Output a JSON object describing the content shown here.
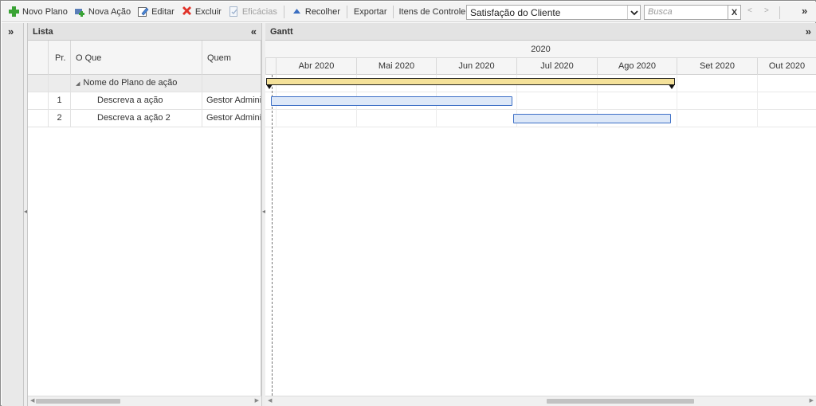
{
  "toolbar": {
    "new_plan": "Novo Plano",
    "new_action": "Nova Ação",
    "edit": "Editar",
    "delete": "Excluir",
    "efficacies": "Eficácias",
    "collapse": "Recolher",
    "export": "Exportar",
    "control_items_label": "Itens de Controle:",
    "control_items_value": "Satisfação do Cliente",
    "search_placeholder": "Busca",
    "clear_label": "X",
    "prev_label": "<",
    "next_label": ">",
    "more_label": "»"
  },
  "left_strip": {
    "expand_label": "»"
  },
  "list_panel": {
    "title": "Lista",
    "collapse_label": "«",
    "columns": {
      "priority": "Pr.",
      "what": "O Que",
      "who": "Quem"
    },
    "group_row": {
      "label": "Nome do Plano de ação"
    },
    "rows": [
      {
        "priority": "1",
        "what": "Descreva a ação",
        "who": "Gestor Administrador"
      },
      {
        "priority": "2",
        "what": "Descreva a ação 2",
        "who": "Gestor Administrador"
      }
    ]
  },
  "gantt_panel": {
    "title": "Gantt",
    "expand_label": "»",
    "year": "2020",
    "months": [
      "Abr 2020",
      "Mai 2020",
      "Jun 2020",
      "Jul 2020",
      "Ago 2020",
      "Set 2020",
      "Out 2020"
    ]
  },
  "colors": {
    "summary_fill": "#f4e199",
    "task_fill": "#dde8f8",
    "task_border": "#3d6fc6",
    "add_icon": "#3aa335",
    "delete_icon": "#e0332a",
    "collapse_icon": "#3b6fc1"
  },
  "icons": {
    "new_plan": "plus-icon",
    "new_action": "add-action-icon",
    "edit": "edit-icon",
    "delete": "delete-x-icon",
    "efficacies": "document-check-icon",
    "collapse": "triangle-up-icon"
  }
}
